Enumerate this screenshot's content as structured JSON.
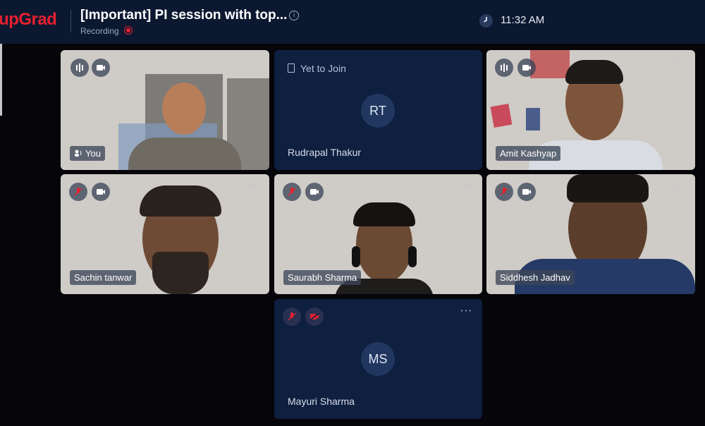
{
  "header": {
    "logo": "upGrad",
    "title": "[Important] PI session with top...",
    "recording_label": "Recording",
    "time": "11:32 AM"
  },
  "participants": [
    {
      "name": "You",
      "state": "video",
      "mic": "speaking",
      "camera": "on"
    },
    {
      "name": "Rudrapal Thakur",
      "initials": "RT",
      "status": "Yet to Join"
    },
    {
      "name": "Amit Kashyap",
      "state": "video",
      "mic": "speaking",
      "camera": "on"
    },
    {
      "name": "Sachin tanwar",
      "state": "video",
      "mic": "muted",
      "camera": "on"
    },
    {
      "name": "Saurabh Sharma",
      "state": "video",
      "mic": "muted",
      "camera": "on"
    },
    {
      "name": "Siddhesh Jadhav",
      "state": "video",
      "mic": "muted",
      "camera": "on"
    },
    {
      "name": "Mayuri Sharma",
      "initials": "MS",
      "mic": "muted",
      "camera": "off"
    }
  ],
  "icons": {
    "more": "more-options-icon",
    "mic_muted": "mic-muted-icon",
    "camera": "camera-icon",
    "speaking": "audio-level-icon",
    "clock": "clock-icon",
    "info": "info-icon"
  },
  "colors": {
    "brand": "#e8202f",
    "tile_bg": "#0e1f40",
    "topbar": "#0c1830"
  }
}
